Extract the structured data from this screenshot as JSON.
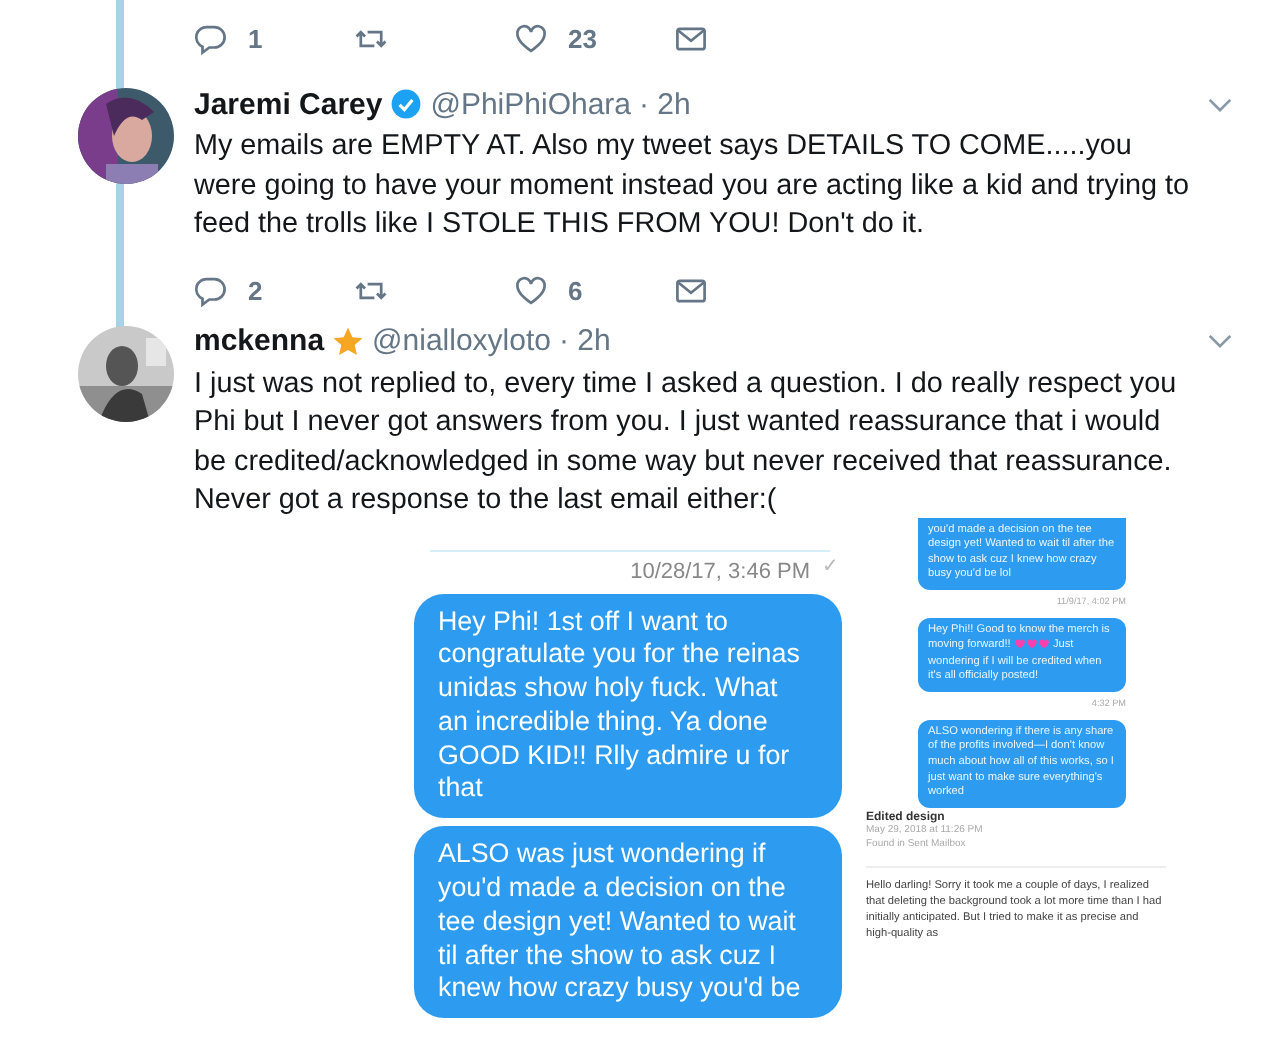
{
  "previous_tweet_actions": {
    "replies": "1",
    "likes": "23"
  },
  "tweets": [
    {
      "name": "Jaremi Carey",
      "verified": true,
      "starred": false,
      "handle": "@PhiPhiOhara",
      "time": "· 2h",
      "text": "My emails are EMPTY AT. Also my tweet says DETAILS TO COME.....you were going to have your moment instead you are acting like a kid and trying to feed the trolls like I STOLE THIS FROM YOU! Don't do it.",
      "replies": "2",
      "likes": "6"
    },
    {
      "name": "mckenna",
      "verified": false,
      "starred": true,
      "handle": "@nialloxyloto",
      "time": "· 2h",
      "text": "I just was not replied to, every time I asked a question. I do really respect you Phi but I never got answers from you. I just wanted reassurance that i would be credited/acknowledged in some way but never received that reassurance. Never got a response to the last email either:(",
      "media": {
        "conversation": {
          "timestamp": "10/28/17, 3:46 PM",
          "status_icon": "✓",
          "bubbles": [
            {
              "text": "Hey Phi! 1st off I want to congratulate you for the reinas unidas show holy fuck. What an incredible thing. Ya done GOOD KID!! Rlly admire u for that"
            },
            {
              "text": "ALSO was just wondering if you'd made a decision on the tee design yet! Wanted to wait til after the show to ask cuz I knew how crazy busy you'd be"
            }
          ]
        },
        "side": {
          "items": [
            {
              "kind": "bubble",
              "text": "you'd made a decision on the tee design yet! Wanted to wait til after the show to ask cuz I knew how crazy busy you'd be lol",
              "hearts": false
            },
            {
              "kind": "timestamp",
              "text": "11/9/17, 4:02 PM"
            },
            {
              "kind": "bubble",
              "text": "Hey Phi!! Good to know the merch is moving forward!!",
              "hearts": true,
              "text_after": "Just wondering if I will be credited when it's all officially posted!"
            },
            {
              "kind": "timestamp",
              "text": "4:32 PM"
            },
            {
              "kind": "bubble",
              "text": "ALSO wondering if there is any share of the profits involved—I don't know much about how all of this works, so I just want to make sure everything's worked",
              "hearts": false
            }
          ],
          "email": {
            "subject": "Edited design",
            "date": "May 29, 2018 at 11:26 PM",
            "folder": "Found in Sent Mailbox",
            "body": "Hello darling! Sorry it took me a couple of days, I realized that deleting the background took a lot more time than I had initially anticipated.  But I tried to make it as precise and high-quality as"
          }
        }
      }
    }
  ]
}
